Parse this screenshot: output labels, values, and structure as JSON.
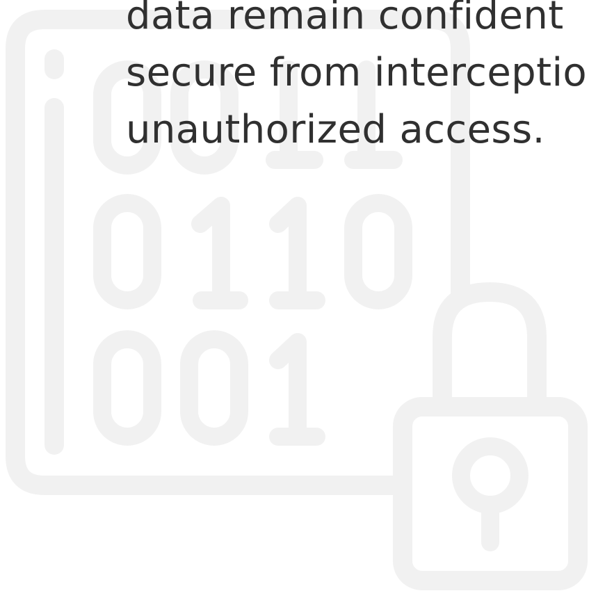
{
  "illustration": {
    "name": "encrypted-data-lock-icon",
    "color": "#f1f1f1",
    "binary_rows": [
      "0011",
      "0110",
      "001"
    ]
  },
  "text": {
    "lines": [
      "data remain confident",
      "secure from interceptio",
      "unauthorized access."
    ],
    "color": "#303030"
  }
}
